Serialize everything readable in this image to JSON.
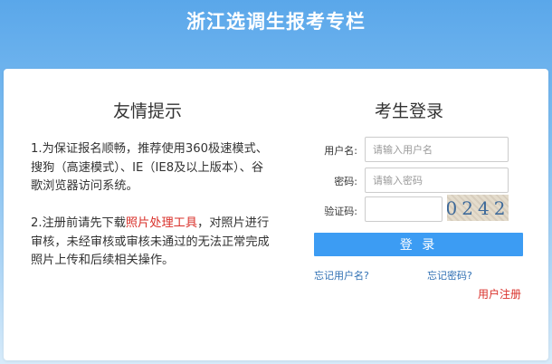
{
  "header": {
    "title": "浙江选调生报考专栏"
  },
  "notice": {
    "title": "友情提示",
    "p1": "1.为保证报名顺畅，推荐使用360极速模式、搜狗（高速模式）、IE（IE8及以上版本）、谷歌浏览器访问系统。",
    "p2_prefix": "2.注册前请先下载",
    "p2_link": "照片处理工具",
    "p2_suffix": "，对照片进行审核，未经审核或审核未通过的无法正常完成照片上传和后续相关操作。"
  },
  "login": {
    "title": "考生登录",
    "username_label": "用户名:",
    "username_placeholder": "请输入用户名",
    "username_value": "",
    "password_label": "密码:",
    "password_placeholder": "请输入密码",
    "password_value": "",
    "captcha_label": "验证码:",
    "captcha_value": "",
    "captcha_text": "0242",
    "button_label": "登 录",
    "forgot_username": "忘记用户名?",
    "forgot_password": "忘记密码?",
    "register": "用户注册"
  },
  "colors": {
    "accent": "#3c9cf3",
    "link": "#2f6fb3",
    "highlight": "#d9302a"
  }
}
